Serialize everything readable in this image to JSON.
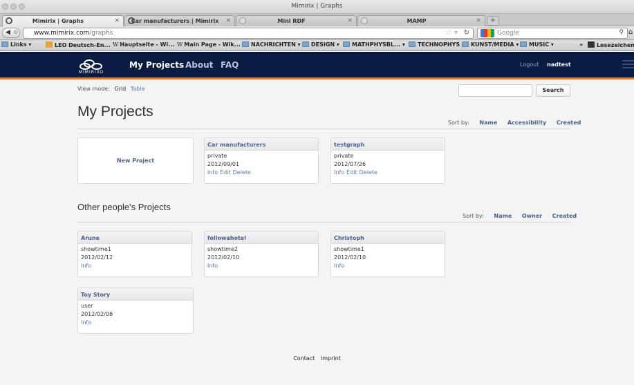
{
  "window": {
    "title": "Mimirix | Graphs"
  },
  "tabs": [
    {
      "label": "Mimirix | Graphs",
      "active": true
    },
    {
      "label": "Car manufacturers | Mimirix",
      "active": false
    },
    {
      "label": "Mini RDF",
      "active": false
    },
    {
      "label": "MAMP",
      "active": false
    }
  ],
  "tab_close": "×",
  "tab_new": "+",
  "nav": {
    "url_host": "www.mimirix.com",
    "url_path": "/graphs",
    "search_engine": "Google"
  },
  "bookmarks": [
    "Links ▾",
    "LEO Deutsch-En...",
    "Hauptseite - Wi...",
    "Main Page - Wik...",
    "NACHRICHTEN ▾",
    "DESIGN ▾",
    "MATHPHYSBL... ▾",
    "TECHNOPHYS ▾",
    "KUNST/MEDIA ▾",
    "MUSIC ▾",
    "»",
    "Lesezeichen ▾"
  ],
  "site": {
    "logo_text": "MIMIRIXO",
    "menu": [
      "My Projects",
      "About",
      "FAQ"
    ],
    "logout": "Logout",
    "username": "nadtest"
  },
  "page": {
    "view_mode_label": "View mode:",
    "view_grid": "Grid",
    "view_table": "Table",
    "search_button": "Search",
    "my_projects_title": "My Projects",
    "sort_by": "Sort by:",
    "my_sort": [
      "Name",
      "Accessibility",
      "Created"
    ],
    "new_project": "New Project",
    "my_projects": [
      {
        "title": "Car manufacturers",
        "line1": "private",
        "line2": "2012/09/01",
        "actions": [
          "Info",
          "Edit",
          "Delete"
        ]
      },
      {
        "title": "testgraph",
        "line1": "private",
        "line2": "2012/07/26",
        "actions": [
          "Info",
          "Edit",
          "Delete"
        ]
      }
    ],
    "other_title": "Other people's Projects",
    "other_sort": [
      "Name",
      "Owner",
      "Created"
    ],
    "other_projects": [
      {
        "title": "Arune",
        "line1": "showtime1",
        "line2": "2012/02/12",
        "actions": [
          "Info"
        ]
      },
      {
        "title": "followahotel",
        "line1": "showtime2",
        "line2": "2012/02/10",
        "actions": [
          "Info"
        ]
      },
      {
        "title": "Christoph",
        "line1": "showtime1",
        "line2": "2012/02/10",
        "actions": [
          "Info"
        ]
      },
      {
        "title": "Toy Story",
        "line1": "user",
        "line2": "2012/02/08",
        "actions": [
          "Info"
        ]
      }
    ],
    "footer": [
      "Contact",
      "Imprint"
    ]
  }
}
